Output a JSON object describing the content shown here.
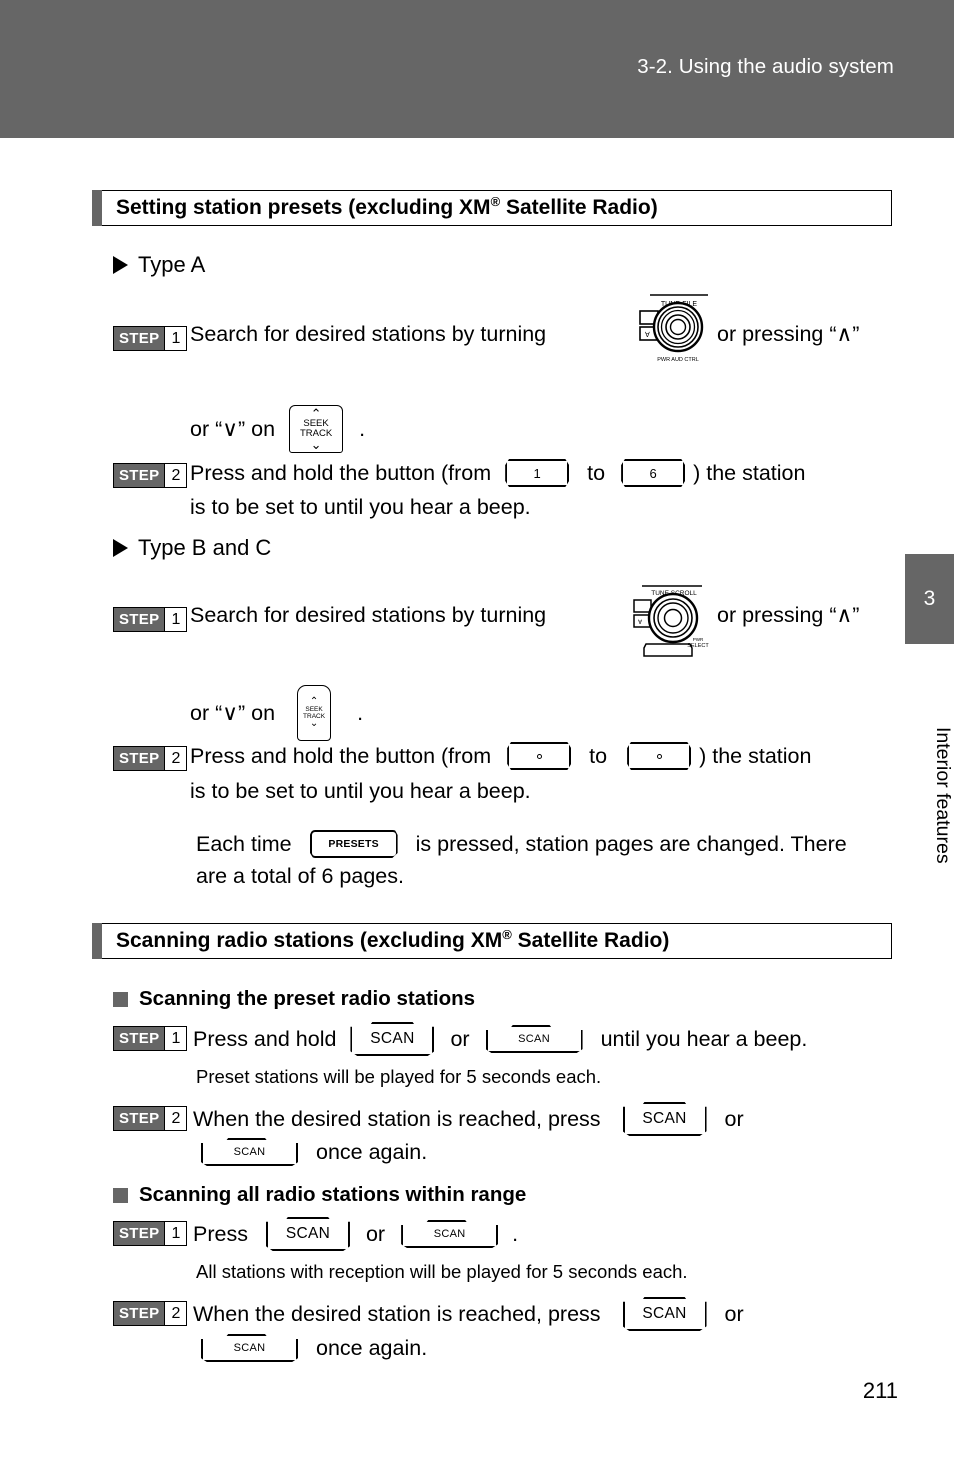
{
  "header": {
    "title": "3-2. Using the audio system"
  },
  "side_tab": {
    "chapter_number": "3",
    "chapter_name": "Interior features"
  },
  "page_number": "211",
  "sections": [
    {
      "title_prefix": "Setting station presets (excluding XM",
      "title_reg": "®",
      "title_suffix": " Satellite Radio)"
    },
    {
      "title_prefix": "Scanning radio stations (excluding XM",
      "title_reg": "®",
      "title_suffix": " Satellite Radio)"
    }
  ],
  "type_a": {
    "label": "Type A",
    "step1": {
      "step_word": "STEP",
      "step_num": "1",
      "text_1": "Search  for  desired  stations  by  turning",
      "text_2": "or pressing “",
      "caret_up": "∧",
      "text_3": "”",
      "line2_pre": "or “",
      "caret_down": "∨",
      "line2_post": "” on",
      "line2_end": "."
    },
    "step2": {
      "step_word": "STEP",
      "step_num": "2",
      "text_1": "Press and hold the button (from",
      "btn_from": "1",
      "text_to": "to",
      "btn_to": "6",
      "text_2": ") the station",
      "line2": "is to be set to until you hear a beep."
    },
    "knob": {
      "top_label": "TUNE·FILE",
      "bottom_label": "PWR AUD CTRL"
    },
    "seek_button": {
      "up": "⌃",
      "line1": "SEEK",
      "line2": "TRACK",
      "down": "⌄"
    }
  },
  "type_bc": {
    "label": "Type B and C",
    "step1": {
      "step_word": "STEP",
      "step_num": "1",
      "text_1": "Search  for  desired  stations  by  turning",
      "text_2": "or pressing “",
      "caret_up": "∧",
      "text_3": "”",
      "line2_pre": "or “",
      "caret_down": "∨",
      "line2_post": "” on",
      "line2_end": "."
    },
    "step2": {
      "step_word": "STEP",
      "step_num": "2",
      "text_1": "Press and hold the button (from",
      "text_to": "to",
      "text_2": ") the station",
      "line2": "is to be set to until you hear a beep."
    },
    "knob": {
      "top_label": "TUNE SCROLL",
      "side_label_1": "PWR",
      "side_label_2": "SELECT"
    },
    "seek_button": {
      "up": "⌃",
      "line1": "SEEK",
      "line2": "TRACK",
      "down": "⌄"
    },
    "note": {
      "pre": "Each time",
      "button_label": "PRESETS",
      "post": "is pressed, station pages are changed. There",
      "line2": "are a total of 6 pages."
    }
  },
  "scanning": {
    "preset_heading": "Scanning the preset radio stations",
    "preset_step1": {
      "step_word": "STEP",
      "step_num": "1",
      "text_1": "Press and hold",
      "btn_a": "SCAN",
      "text_or": "or",
      "btn_b": "SCAN",
      "text_2": "until you hear a beep."
    },
    "preset_note": "Preset stations will be played for 5 seconds each.",
    "preset_step2": {
      "step_word": "STEP",
      "step_num": "2",
      "text_1": "When  the  desired  station  is  reached,  press",
      "btn_a": "SCAN",
      "text_or": "or",
      "btn_b": "SCAN",
      "text_2": "once again."
    },
    "all_heading": "Scanning all radio stations within range",
    "all_step1": {
      "step_word": "STEP",
      "step_num": "1",
      "text_1": "Press",
      "btn_a": "SCAN",
      "text_or": "or",
      "btn_b": "SCAN",
      "text_2": "."
    },
    "all_note": "All stations with reception will be played for 5 seconds each.",
    "all_step2": {
      "step_word": "STEP",
      "step_num": "2",
      "text_1": "When  the  desired  station  is  reached,  press",
      "btn_a": "SCAN",
      "text_or": "or",
      "btn_b": "SCAN",
      "text_2": "once again."
    }
  },
  "colors": {
    "header_gray": "#666666",
    "text_black": "#000000",
    "page_white": "#ffffff"
  }
}
